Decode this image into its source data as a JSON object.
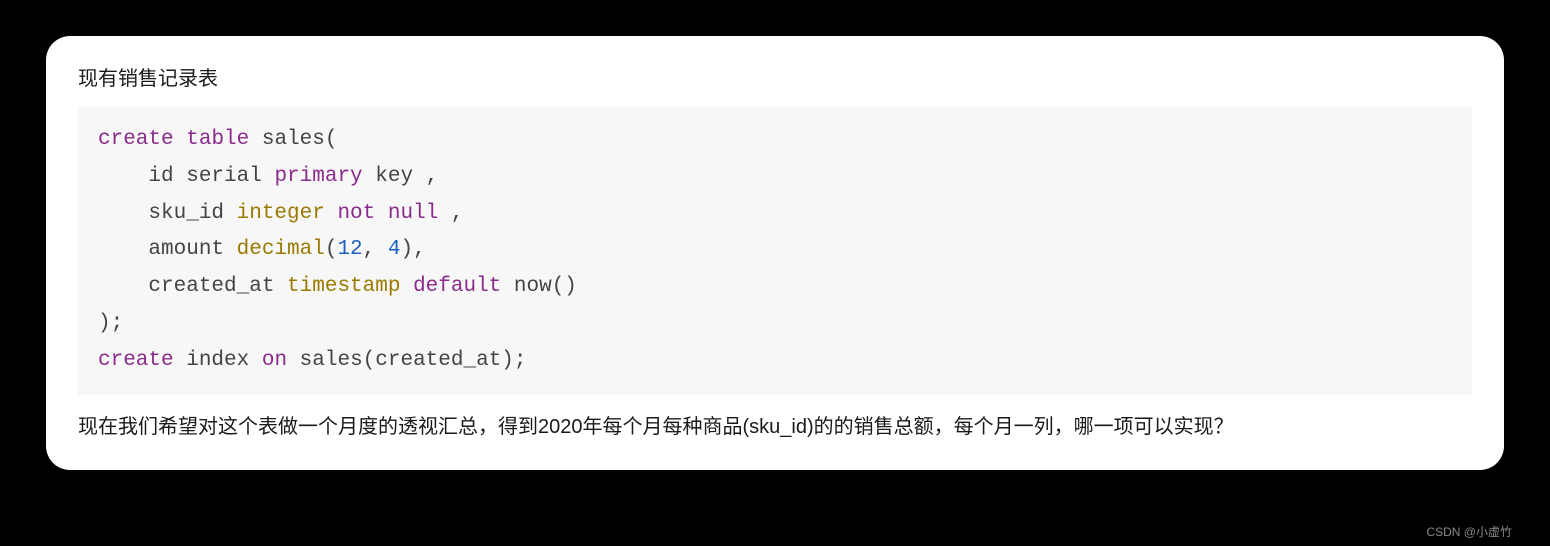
{
  "intro": "现有销售记录表",
  "code": {
    "l1": {
      "a": "create",
      "b": "table",
      "c": " sales("
    },
    "l2": {
      "a": "    id serial ",
      "b": "primary",
      "c": " key ,"
    },
    "l3": {
      "a": "    sku_id ",
      "b": "integer",
      "c": " ",
      "d": "not",
      "e": " ",
      "f": "null",
      "g": " ,"
    },
    "l4": {
      "a": "    amount ",
      "b": "decimal",
      "c": "(",
      "d": "12",
      "e": ", ",
      "f": "4",
      "g": "),"
    },
    "l5": {
      "a": "    created_at ",
      "b": "timestamp",
      "c": " ",
      "d": "default",
      "e": " now()"
    },
    "l6": {
      "a": ");"
    },
    "l7": {
      "a": "create",
      "b": " index ",
      "c": "on",
      "d": " sales(created_at);"
    }
  },
  "question": "现在我们希望对这个表做一个月度的透视汇总，得到2020年每个月每种商品(sku_id)的的销售总额，每个月一列，哪一项可以实现？",
  "watermark": "CSDN @小虚竹"
}
